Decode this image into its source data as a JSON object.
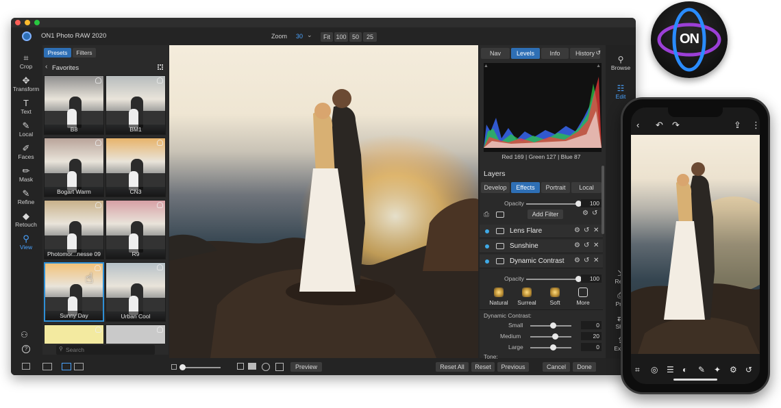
{
  "app": {
    "title": "ON1 Photo RAW 2020"
  },
  "zoom": {
    "label": "Zoom",
    "value": "30",
    "presets": [
      "Fit",
      "100",
      "50",
      "25"
    ]
  },
  "left_tools": [
    {
      "label": "Crop",
      "icon": "crop-icon",
      "glyph": "⌗"
    },
    {
      "label": "Transform",
      "icon": "transform-icon",
      "glyph": "✥"
    },
    {
      "label": "Text",
      "icon": "text-icon",
      "glyph": "T"
    },
    {
      "label": "Local",
      "icon": "brush-icon",
      "glyph": "✎"
    },
    {
      "label": "Faces",
      "icon": "faces-icon",
      "glyph": "✐"
    },
    {
      "label": "Mask",
      "icon": "mask-icon",
      "glyph": "✏"
    },
    {
      "label": "Refine",
      "icon": "refine-icon",
      "glyph": "✎"
    },
    {
      "label": "Retouch",
      "icon": "retouch-icon",
      "glyph": "◆"
    },
    {
      "label": "View",
      "icon": "view-icon",
      "glyph": "⚲"
    }
  ],
  "browser": {
    "tabs": [
      "Presets",
      "Filters"
    ],
    "section": "Favorites",
    "presets": [
      "B8",
      "BM1",
      "Bogart Warm",
      "CN3",
      "Photomor...nesse 09",
      "R9",
      "Sunny Day",
      "Urban Cool"
    ],
    "search_placeholder": "Search"
  },
  "right_tabs": [
    "Nav",
    "Levels",
    "Info",
    "History"
  ],
  "histogram": {
    "readout": "Red 169 | Green 127 | Blue  87"
  },
  "layers": {
    "title": "Layers",
    "tabs": [
      "Develop",
      "Effects",
      "Portrait",
      "Local"
    ],
    "opacity_label": "Opacity",
    "opacity_value": "100",
    "add_filter": "Add Filter",
    "filters": [
      "Lens Flare",
      "Sunshine",
      "Dynamic Contrast"
    ],
    "filter_opacity_label": "Opacity",
    "filter_opacity_value": "100",
    "styles": [
      "Natural",
      "Surreal",
      "Soft",
      "More"
    ],
    "section_label": "Dynamic Contrast:",
    "sliders": [
      {
        "label": "Small",
        "value": "0",
        "level": 0.55
      },
      {
        "label": "Medium",
        "value": "20",
        "level": 0.6
      },
      {
        "label": "Large",
        "value": "0",
        "level": 0.55
      }
    ],
    "tone_label": "Tone:"
  },
  "right_bar": [
    {
      "label": "Browse",
      "icon": "browse-icon"
    },
    {
      "label": "Edit",
      "icon": "edit-icon"
    },
    {
      "label": "Resi",
      "icon": "resize-icon"
    },
    {
      "label": "Prin",
      "icon": "print-icon"
    },
    {
      "label": "Sha",
      "icon": "share-icon"
    },
    {
      "label": "Expo",
      "icon": "export-icon"
    }
  ],
  "bottom": {
    "preview": "Preview",
    "actions": [
      "Reset All",
      "Reset",
      "Previous"
    ],
    "cancel": "Cancel",
    "done": "Done"
  },
  "logo": {
    "text": "ON"
  },
  "colors": {
    "accent": "#2e6fb5",
    "panel": "#2a2a2a",
    "logo_ring": "#9b3fd6",
    "logo_ring2": "#2a8cff"
  }
}
